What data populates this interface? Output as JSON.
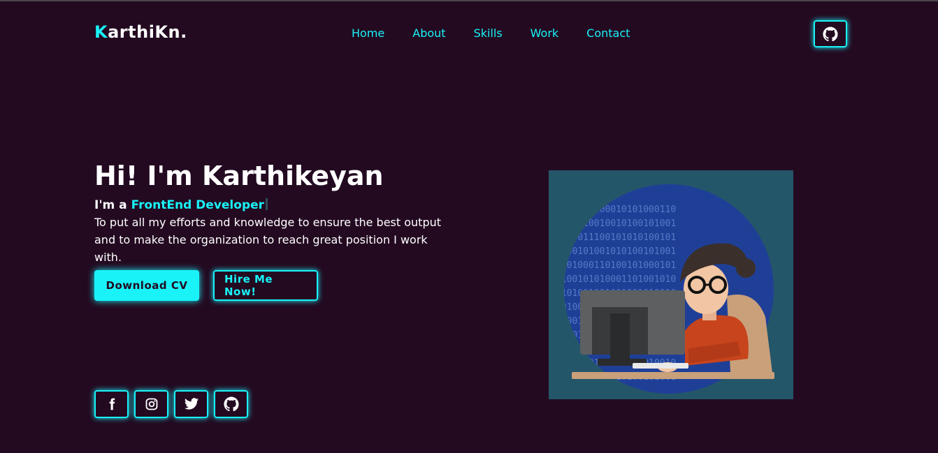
{
  "brand": {
    "first_letter": "K",
    "rest": "arthiKn."
  },
  "nav": {
    "items": [
      "Home",
      "About",
      "Skills",
      "Work",
      "Contact"
    ]
  },
  "header": {
    "github_icon": "github-icon"
  },
  "hero": {
    "title": "Hi! I'm Karthikeyan",
    "role_prefix": "I'm a ",
    "role_highlight": "FrontEnd Developer",
    "description": "To put all my efforts and knowledge to ensure the best output and to make the organization to reach great position I work with.",
    "download_label": "Download CV",
    "hire_label": "Hire Me Now!"
  },
  "social": {
    "icons": [
      "facebook-icon",
      "instagram-icon",
      "twitter-icon",
      "github-icon"
    ]
  },
  "illustration": {
    "icon": "developer-at-computer-illustration"
  },
  "colors": {
    "accent": "#19f3f8",
    "background": "#230a21",
    "text": "#ffffff"
  }
}
